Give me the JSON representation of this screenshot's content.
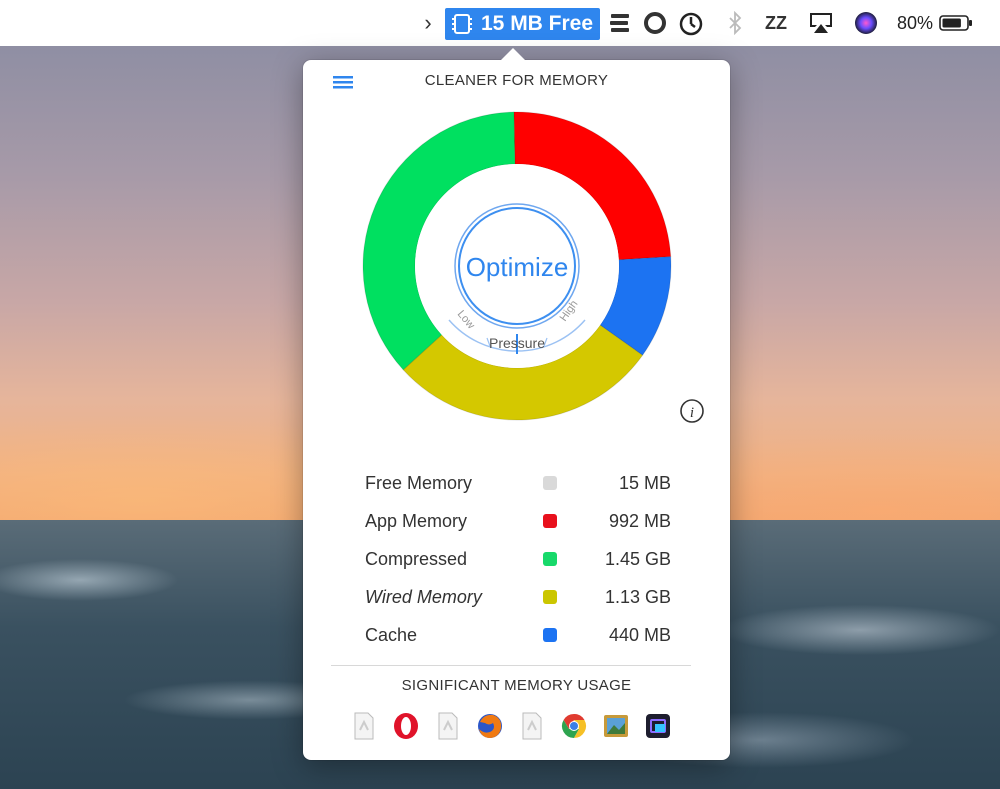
{
  "menubar": {
    "chevron": "›",
    "status_text": "15 MB Free",
    "zz": "ZZ",
    "battery_percent": "80%",
    "battery_level": 0.8,
    "icons": [
      "chip-icon",
      "stack-icon",
      "ring-icon",
      "timer-icon",
      "bluetooth-icon",
      "sleep-icon",
      "airplay-icon",
      "siri-icon",
      "battery-icon"
    ]
  },
  "popover": {
    "title": "CLEANER FOR MEMORY",
    "optimize_label": "Optimize",
    "gauge": {
      "low": "Low",
      "label": "Pressure",
      "high": "High"
    },
    "info_icon": "i"
  },
  "chart_data": {
    "type": "pie",
    "series": [
      {
        "name": "App Memory",
        "value": 992,
        "color": "#ff0000"
      },
      {
        "name": "Cache",
        "value": 440,
        "color": "#1c73f2"
      },
      {
        "name": "Wired Memory",
        "value": 1157,
        "color": "#d4c800"
      },
      {
        "name": "Compressed",
        "value": 1485,
        "color": "#00e060"
      }
    ]
  },
  "legend": [
    {
      "label": "Free Memory",
      "value": "15 MB",
      "color": "#d9d9d9"
    },
    {
      "label": "App Memory",
      "value": "992 MB",
      "color": "#e8101c"
    },
    {
      "label": "Compressed",
      "value": "1.45 GB",
      "color": "#17d96a"
    },
    {
      "label": "Wired Memory",
      "value": "1.13 GB",
      "color": "#cbc600"
    },
    {
      "label": "Cache",
      "value": "440 MB",
      "color": "#1c73f2"
    }
  ],
  "usage": {
    "title": "SIGNIFICANT MEMORY USAGE",
    "apps": [
      "generic-app-icon",
      "opera-icon",
      "generic-app-icon",
      "firefox-icon",
      "generic-app-icon",
      "chrome-icon",
      "preview-icon",
      "screen-app-icon"
    ]
  }
}
